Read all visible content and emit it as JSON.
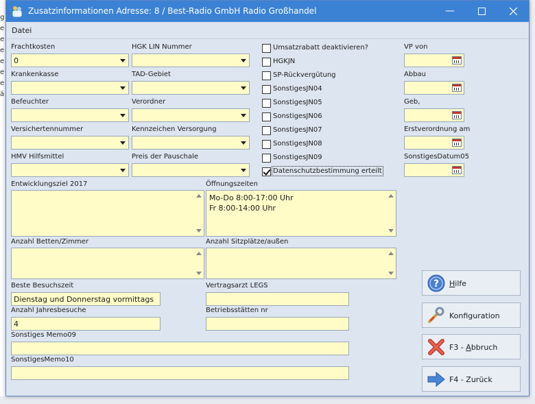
{
  "window": {
    "title": "Zusatzinformationen Adresse: 8 / Best-Radio GmbH Radio Großhandel"
  },
  "menu": {
    "datei": "Datei"
  },
  "combos": [
    {
      "label": "Frachtkosten",
      "value": "0"
    },
    {
      "label": "HGK LIN Nummer",
      "value": ""
    },
    {
      "label": "Krankenkasse",
      "value": ""
    },
    {
      "label": "TAD-Gebiet",
      "value": ""
    },
    {
      "label": "Befeuchter",
      "value": ""
    },
    {
      "label": "Verordner",
      "value": ""
    },
    {
      "label": "Versichertennummer",
      "value": ""
    },
    {
      "label": "Kennzeichen Versorgung",
      "value": ""
    },
    {
      "label": "HMV Hilfsmittel",
      "value": ""
    },
    {
      "label": "Preis der Pauschale",
      "value": ""
    }
  ],
  "checkboxes": [
    {
      "label": "Umsatzrabatt deaktivieren?",
      "checked": false
    },
    {
      "label": "HGKJN",
      "checked": false
    },
    {
      "label": "SP-Rückvergütung",
      "checked": false
    },
    {
      "label": "SonstigesJN04",
      "checked": false
    },
    {
      "label": "SonstigesJN05",
      "checked": false
    },
    {
      "label": "SonstigesJN06",
      "checked": false
    },
    {
      "label": "SonstigesJN07",
      "checked": false
    },
    {
      "label": "SonstigesJN08",
      "checked": false
    },
    {
      "label": "SonstigesJN09",
      "checked": false
    },
    {
      "label": "Datenschutzbestimmung erteilt",
      "checked": true
    }
  ],
  "dates": [
    {
      "label": "VP von",
      "value": ""
    },
    {
      "label": "Abbau",
      "value": ""
    },
    {
      "label": "Geb,",
      "value": ""
    },
    {
      "label": "Erstverordnung am",
      "value": ""
    },
    {
      "label": "SonstigesDatum05",
      "value": ""
    }
  ],
  "memos": {
    "entwicklungsziel": {
      "label": "Entwicklungsziel 2017",
      "value": ""
    },
    "oeffnungszeiten": {
      "label": "Öffnungszeiten",
      "value": "Mo-Do 8:00-17:00 Uhr\nFr 8:00-14:00 Uhr"
    },
    "betten": {
      "label": "Anzahl Betten/Zimmer",
      "value": ""
    },
    "sitzplaetze": {
      "label": "Anzahl Sitzplätze/außen",
      "value": ""
    }
  },
  "fields": {
    "besuchszeit": {
      "label": "Beste Besuchszeit",
      "value": "Dienstag und Donnerstag vormittags"
    },
    "vertragsarzt": {
      "label": "Vertragsarzt LEGS",
      "value": ""
    },
    "jahresbesuche": {
      "label": "Anzahl Jahresbesuche",
      "value": "4"
    },
    "betriebsstaetten": {
      "label": "Betriebsstätten nr",
      "value": ""
    },
    "memo09": {
      "label": "Sonstiges Memo09",
      "value": ""
    },
    "memo10": {
      "label": "SonstigesMemo10",
      "value": ""
    }
  },
  "buttons": {
    "hilfe": {
      "prefix": "",
      "underline": "H",
      "rest": "ilfe"
    },
    "konfiguration": {
      "prefix": "",
      "underline": "",
      "rest": "Konfiguration"
    },
    "abbruch": {
      "prefix": "F3 - ",
      "underline": "A",
      "rest": "bbruch"
    },
    "zurueck": {
      "prefix": "F4 - Zurück",
      "underline": "",
      "rest": ""
    }
  },
  "colors": {
    "titlebar": "#3b82d4",
    "field_bg": "#fffcc8",
    "dialog_bg": "#dde5f0"
  },
  "icons": [
    "app-icon",
    "minimize-icon",
    "maximize-icon",
    "close-icon",
    "dropdown-arrow-icon",
    "calendar-icon",
    "help-icon",
    "wrench-icon",
    "cancel-x-icon",
    "arrow-right-icon"
  ]
}
